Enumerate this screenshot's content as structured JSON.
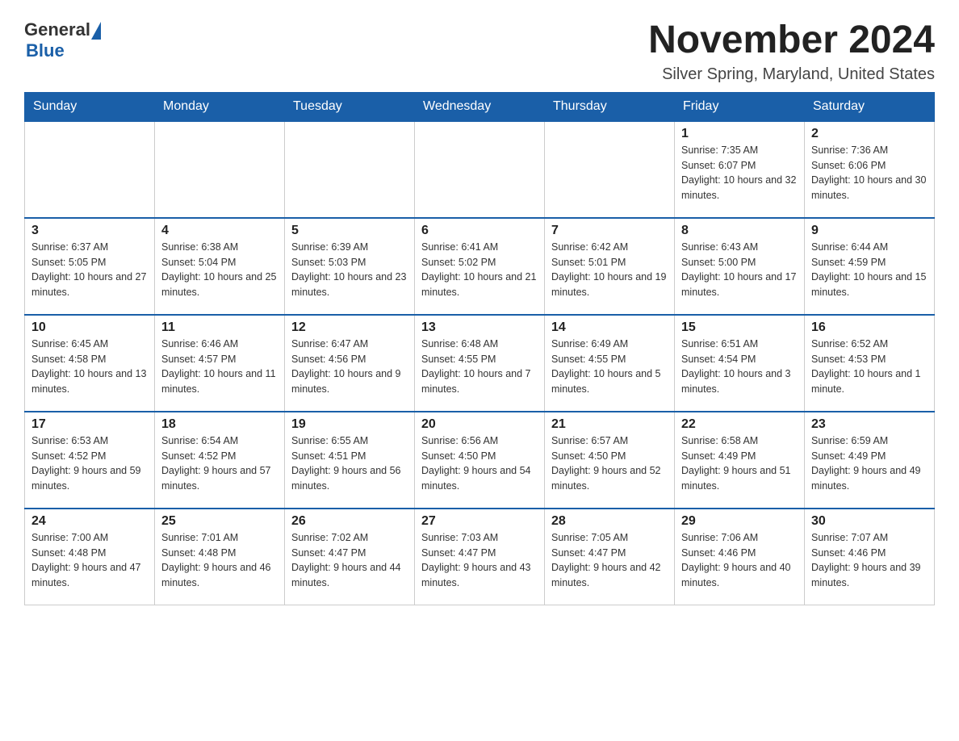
{
  "logo": {
    "text_general": "General",
    "text_blue": "Blue"
  },
  "header": {
    "title": "November 2024",
    "subtitle": "Silver Spring, Maryland, United States"
  },
  "days_of_week": [
    "Sunday",
    "Monday",
    "Tuesday",
    "Wednesday",
    "Thursday",
    "Friday",
    "Saturday"
  ],
  "weeks": [
    [
      {
        "day": "",
        "info": ""
      },
      {
        "day": "",
        "info": ""
      },
      {
        "day": "",
        "info": ""
      },
      {
        "day": "",
        "info": ""
      },
      {
        "day": "",
        "info": ""
      },
      {
        "day": "1",
        "info": "Sunrise: 7:35 AM\nSunset: 6:07 PM\nDaylight: 10 hours and 32 minutes."
      },
      {
        "day": "2",
        "info": "Sunrise: 7:36 AM\nSunset: 6:06 PM\nDaylight: 10 hours and 30 minutes."
      }
    ],
    [
      {
        "day": "3",
        "info": "Sunrise: 6:37 AM\nSunset: 5:05 PM\nDaylight: 10 hours and 27 minutes."
      },
      {
        "day": "4",
        "info": "Sunrise: 6:38 AM\nSunset: 5:04 PM\nDaylight: 10 hours and 25 minutes."
      },
      {
        "day": "5",
        "info": "Sunrise: 6:39 AM\nSunset: 5:03 PM\nDaylight: 10 hours and 23 minutes."
      },
      {
        "day": "6",
        "info": "Sunrise: 6:41 AM\nSunset: 5:02 PM\nDaylight: 10 hours and 21 minutes."
      },
      {
        "day": "7",
        "info": "Sunrise: 6:42 AM\nSunset: 5:01 PM\nDaylight: 10 hours and 19 minutes."
      },
      {
        "day": "8",
        "info": "Sunrise: 6:43 AM\nSunset: 5:00 PM\nDaylight: 10 hours and 17 minutes."
      },
      {
        "day": "9",
        "info": "Sunrise: 6:44 AM\nSunset: 4:59 PM\nDaylight: 10 hours and 15 minutes."
      }
    ],
    [
      {
        "day": "10",
        "info": "Sunrise: 6:45 AM\nSunset: 4:58 PM\nDaylight: 10 hours and 13 minutes."
      },
      {
        "day": "11",
        "info": "Sunrise: 6:46 AM\nSunset: 4:57 PM\nDaylight: 10 hours and 11 minutes."
      },
      {
        "day": "12",
        "info": "Sunrise: 6:47 AM\nSunset: 4:56 PM\nDaylight: 10 hours and 9 minutes."
      },
      {
        "day": "13",
        "info": "Sunrise: 6:48 AM\nSunset: 4:55 PM\nDaylight: 10 hours and 7 minutes."
      },
      {
        "day": "14",
        "info": "Sunrise: 6:49 AM\nSunset: 4:55 PM\nDaylight: 10 hours and 5 minutes."
      },
      {
        "day": "15",
        "info": "Sunrise: 6:51 AM\nSunset: 4:54 PM\nDaylight: 10 hours and 3 minutes."
      },
      {
        "day": "16",
        "info": "Sunrise: 6:52 AM\nSunset: 4:53 PM\nDaylight: 10 hours and 1 minute."
      }
    ],
    [
      {
        "day": "17",
        "info": "Sunrise: 6:53 AM\nSunset: 4:52 PM\nDaylight: 9 hours and 59 minutes."
      },
      {
        "day": "18",
        "info": "Sunrise: 6:54 AM\nSunset: 4:52 PM\nDaylight: 9 hours and 57 minutes."
      },
      {
        "day": "19",
        "info": "Sunrise: 6:55 AM\nSunset: 4:51 PM\nDaylight: 9 hours and 56 minutes."
      },
      {
        "day": "20",
        "info": "Sunrise: 6:56 AM\nSunset: 4:50 PM\nDaylight: 9 hours and 54 minutes."
      },
      {
        "day": "21",
        "info": "Sunrise: 6:57 AM\nSunset: 4:50 PM\nDaylight: 9 hours and 52 minutes."
      },
      {
        "day": "22",
        "info": "Sunrise: 6:58 AM\nSunset: 4:49 PM\nDaylight: 9 hours and 51 minutes."
      },
      {
        "day": "23",
        "info": "Sunrise: 6:59 AM\nSunset: 4:49 PM\nDaylight: 9 hours and 49 minutes."
      }
    ],
    [
      {
        "day": "24",
        "info": "Sunrise: 7:00 AM\nSunset: 4:48 PM\nDaylight: 9 hours and 47 minutes."
      },
      {
        "day": "25",
        "info": "Sunrise: 7:01 AM\nSunset: 4:48 PM\nDaylight: 9 hours and 46 minutes."
      },
      {
        "day": "26",
        "info": "Sunrise: 7:02 AM\nSunset: 4:47 PM\nDaylight: 9 hours and 44 minutes."
      },
      {
        "day": "27",
        "info": "Sunrise: 7:03 AM\nSunset: 4:47 PM\nDaylight: 9 hours and 43 minutes."
      },
      {
        "day": "28",
        "info": "Sunrise: 7:05 AM\nSunset: 4:47 PM\nDaylight: 9 hours and 42 minutes."
      },
      {
        "day": "29",
        "info": "Sunrise: 7:06 AM\nSunset: 4:46 PM\nDaylight: 9 hours and 40 minutes."
      },
      {
        "day": "30",
        "info": "Sunrise: 7:07 AM\nSunset: 4:46 PM\nDaylight: 9 hours and 39 minutes."
      }
    ]
  ]
}
